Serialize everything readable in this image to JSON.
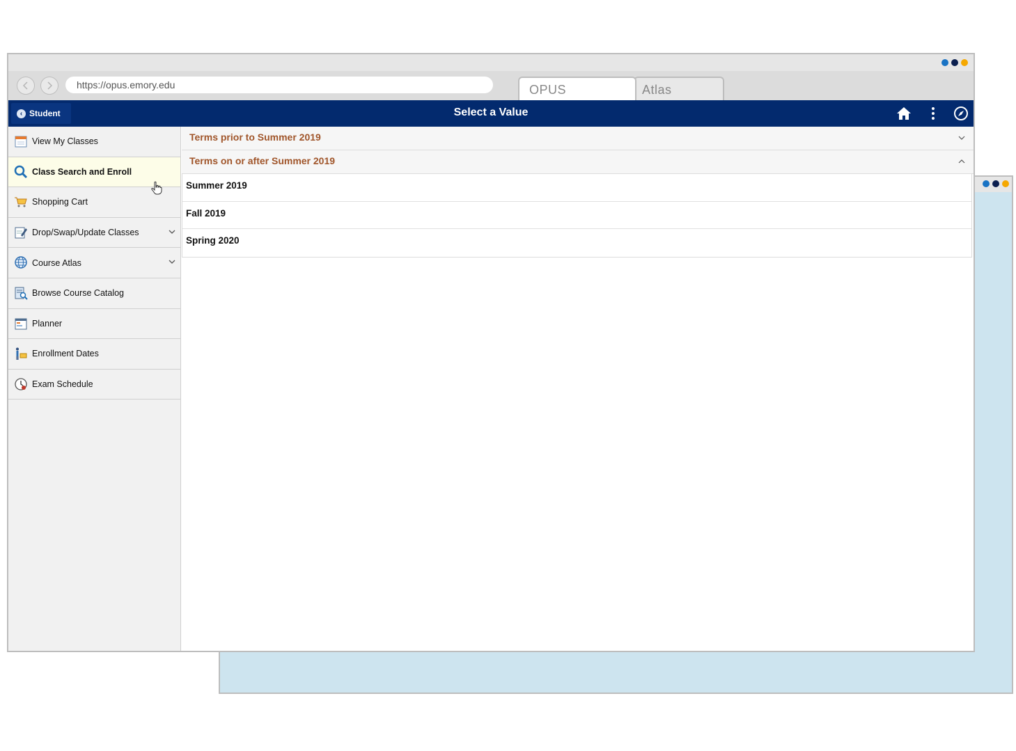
{
  "colors": {
    "dot_blue": "#1a73c4",
    "dot_navy": "#0b1f4f",
    "dot_gold": "#f5a800",
    "header_bg": "#032a6e",
    "group_text": "#a0552a",
    "back_window_bg": "#cde4ef"
  },
  "browser": {
    "url": "https://opus.emory.edu",
    "tabs": [
      {
        "label": "OPUS",
        "active": true
      },
      {
        "label": "Atlas",
        "active": false
      }
    ]
  },
  "header": {
    "back_label": "Student",
    "title": "Select a Value",
    "icons": [
      "home-icon",
      "more-vertical-icon",
      "navigation-compass-icon"
    ]
  },
  "sidebar": {
    "items": [
      {
        "label": "View My Classes",
        "icon": "calendar-icon",
        "expandable": false
      },
      {
        "label": "Class Search and Enroll",
        "icon": "search-icon",
        "expandable": false,
        "active": true
      },
      {
        "label": "Shopping Cart",
        "icon": "shopping-cart-icon",
        "expandable": false
      },
      {
        "label": "Drop/Swap/Update Classes",
        "icon": "edit-document-icon",
        "expandable": true
      },
      {
        "label": "Course Atlas",
        "icon": "globe-icon",
        "expandable": true
      },
      {
        "label": "Browse Course Catalog",
        "icon": "catalog-search-icon",
        "expandable": false
      },
      {
        "label": "Planner",
        "icon": "planner-icon",
        "expandable": false
      },
      {
        "label": "Enrollment Dates",
        "icon": "enrollment-dates-icon",
        "expandable": false
      },
      {
        "label": "Exam Schedule",
        "icon": "clock-icon",
        "expandable": false
      }
    ]
  },
  "content": {
    "groups": [
      {
        "label": "Terms prior to Summer 2019",
        "expanded": false,
        "terms": []
      },
      {
        "label": "Terms on or after Summer 2019",
        "expanded": true,
        "terms": [
          "Summer 2019",
          "Fall 2019",
          "Spring 2020"
        ]
      }
    ]
  }
}
